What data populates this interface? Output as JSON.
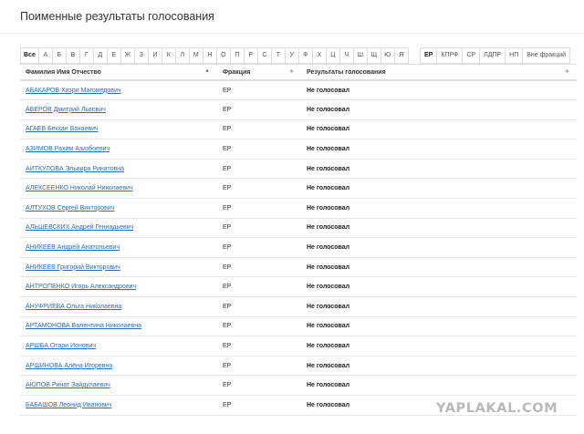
{
  "page": {
    "title": "Поименные результаты голосования"
  },
  "letters": [
    "Все",
    "А",
    "Б",
    "В",
    "Г",
    "Д",
    "Е",
    "Ж",
    "З",
    "И",
    "К",
    "Л",
    "М",
    "Н",
    "О",
    "П",
    "Р",
    "С",
    "Т",
    "У",
    "Ф",
    "Х",
    "Ц",
    "Ч",
    "Ш",
    "Щ",
    "Ю",
    "Я"
  ],
  "active_letter": "Все",
  "factions": [
    "ЕР",
    "КПРФ",
    "СР",
    "ЛДПР",
    "НП",
    "Вне фракций"
  ],
  "active_faction": "ЕР",
  "table": {
    "headers": [
      "Фамилия Имя Отчество",
      "Фракция",
      "Результаты голосования"
    ],
    "rows": [
      {
        "name": "АБАКАРОВ Хизри Магомедович",
        "faction": "ЕР",
        "result": "Не голосовал"
      },
      {
        "name": "АВЕРОВ Дмитрий Львович",
        "faction": "ЕР",
        "result": "Не голосовал"
      },
      {
        "name": "АГАЕВ Бекхан Вахаевич",
        "faction": "ЕР",
        "result": "Не голосовал"
      },
      {
        "name": "АЗИМОВ Рахим Азизбоевич",
        "faction": "ЕР",
        "result": "Не голосовал"
      },
      {
        "name": "АИТКУЛОВА Эльвира Ринатовна",
        "faction": "ЕР",
        "result": "Не голосовал"
      },
      {
        "name": "АЛЕКСЕЕНКО Николай Николаевич",
        "faction": "ЕР",
        "result": "Не голосовал"
      },
      {
        "name": "АЛТУХОВ Сергей Викторович",
        "faction": "ЕР",
        "result": "Не голосовал"
      },
      {
        "name": "АЛЬШЕВСКИХ Андрей Геннадьевич",
        "faction": "ЕР",
        "result": "Не голосовал"
      },
      {
        "name": "АНИКЕЕВ Андрей Анатольевич",
        "faction": "ЕР",
        "result": "Не голосовал"
      },
      {
        "name": "АНИКЕЕВ Григорий Викторович",
        "faction": "ЕР",
        "result": "Не голосовал"
      },
      {
        "name": "АНТРОПЕНКО Игорь Александрович",
        "faction": "ЕР",
        "result": "Не голосовал"
      },
      {
        "name": "АНУФРИЕВА Ольга Николаевна",
        "faction": "ЕР",
        "result": "Не голосовал"
      },
      {
        "name": "АРТАМОНОВА Валентина Николаевна",
        "faction": "ЕР",
        "result": "Не голосовал"
      },
      {
        "name": "АРШБА Отари Ионович",
        "faction": "ЕР",
        "result": "Не голосовал"
      },
      {
        "name": "АРШИНОВА Алёна Игоревна",
        "faction": "ЕР",
        "result": "Не голосовал"
      },
      {
        "name": "АЮПОВ Ринат Зайдулаевич",
        "faction": "ЕР",
        "result": "Не голосовал"
      },
      {
        "name": "БАБАШОВ Леонид Иванович",
        "faction": "ЕР",
        "result": "Не голосовал"
      }
    ]
  },
  "watermark": "YAPLAKAL.COM"
}
